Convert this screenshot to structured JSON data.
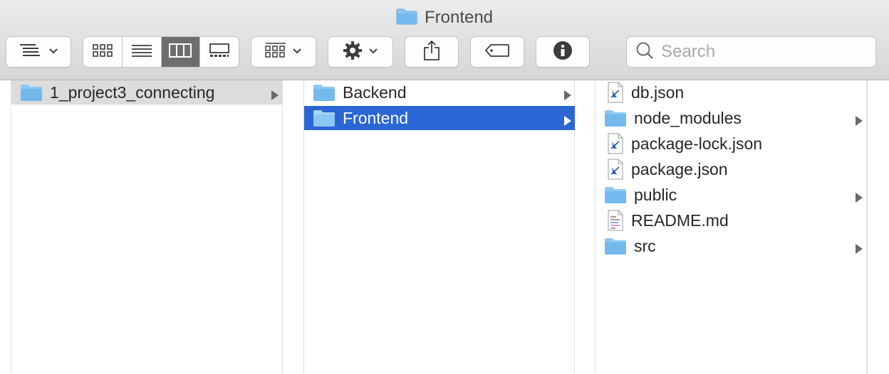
{
  "window": {
    "title": "Frontend",
    "title_icon": "folder-icon"
  },
  "toolbar": {
    "arrange_icon": "list-arrange-icon",
    "view_modes": [
      "icon-view-icon",
      "list-view-icon",
      "column-view-icon",
      "gallery-view-icon"
    ],
    "active_view": "column-view",
    "group_icon": "group-grid-icon",
    "action_icon": "gear-icon",
    "share_icon": "share-icon",
    "tag_icon": "tag-icon",
    "info_icon": "info-icon",
    "search_placeholder": "Search",
    "search_value": ""
  },
  "columns": [
    {
      "items": [
        {
          "name": "1_project3_connecting",
          "type": "folder",
          "state": "selected-inactive",
          "has_children": true
        }
      ]
    },
    {
      "items": [
        {
          "name": "Backend",
          "type": "folder",
          "state": "",
          "has_children": true
        },
        {
          "name": "Frontend",
          "type": "folder",
          "state": "selected-active",
          "has_children": true
        }
      ]
    },
    {
      "items": [
        {
          "name": "db.json",
          "type": "json-file",
          "has_children": false
        },
        {
          "name": "node_modules",
          "type": "folder",
          "has_children": true
        },
        {
          "name": "package-lock.json",
          "type": "json-file",
          "has_children": false
        },
        {
          "name": "package.json",
          "type": "json-file",
          "has_children": false
        },
        {
          "name": "public",
          "type": "folder",
          "has_children": true
        },
        {
          "name": "README.md",
          "type": "text-file",
          "has_children": false
        },
        {
          "name": "src",
          "type": "folder",
          "has_children": true
        }
      ]
    }
  ],
  "colors": {
    "selection_active": "#2a66d4",
    "selection_inactive": "#dcdcdc",
    "folder_blue": "#73b9ee"
  }
}
